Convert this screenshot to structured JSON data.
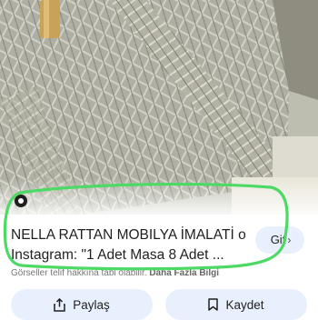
{
  "result": {
    "title_line1": "NELLA RATTAN MOBILYA İMALATİ on",
    "title_line2": "Instagram: \"1 Adet Masa 8 Adet ...",
    "visit_label": "Git",
    "disclaimer": "Görseller telif hakkına tabi olabilir.",
    "more_info": "Daha Fazla Bilgi"
  },
  "actions": {
    "share_label": "Paylaş",
    "save_label": "Kaydet"
  },
  "icons": {
    "source": "instagram-icon",
    "share": "share-icon",
    "save": "bookmark-icon",
    "visit": "chevron-right-icon"
  },
  "colors": {
    "button_bg": "#e8f0fe",
    "highlight": "#4cd964",
    "text": "#1f1f1f"
  }
}
